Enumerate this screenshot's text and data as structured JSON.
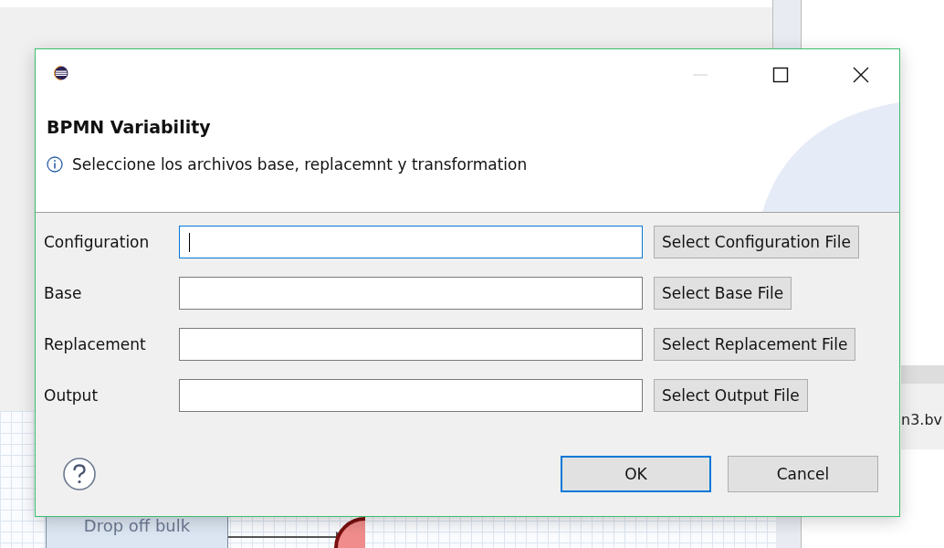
{
  "background": {
    "tab_label": "n3.bv",
    "task_label": "Drop off bulk"
  },
  "dialog": {
    "title": "BPMN Variability",
    "message": "Seleccione los archivos base, replacemnt y transformation",
    "fields": [
      {
        "label": "Configuration",
        "button": "Select Configuration File",
        "focused": true
      },
      {
        "label": "Base",
        "button": "Select Base File",
        "focused": false
      },
      {
        "label": "Replacement",
        "button": "Select Replacement File",
        "focused": false
      },
      {
        "label": "Output",
        "button": "Select Output File",
        "focused": false
      }
    ],
    "buttons": [
      {
        "label": "OK",
        "default": true
      },
      {
        "label": "Cancel",
        "default": false
      }
    ]
  }
}
